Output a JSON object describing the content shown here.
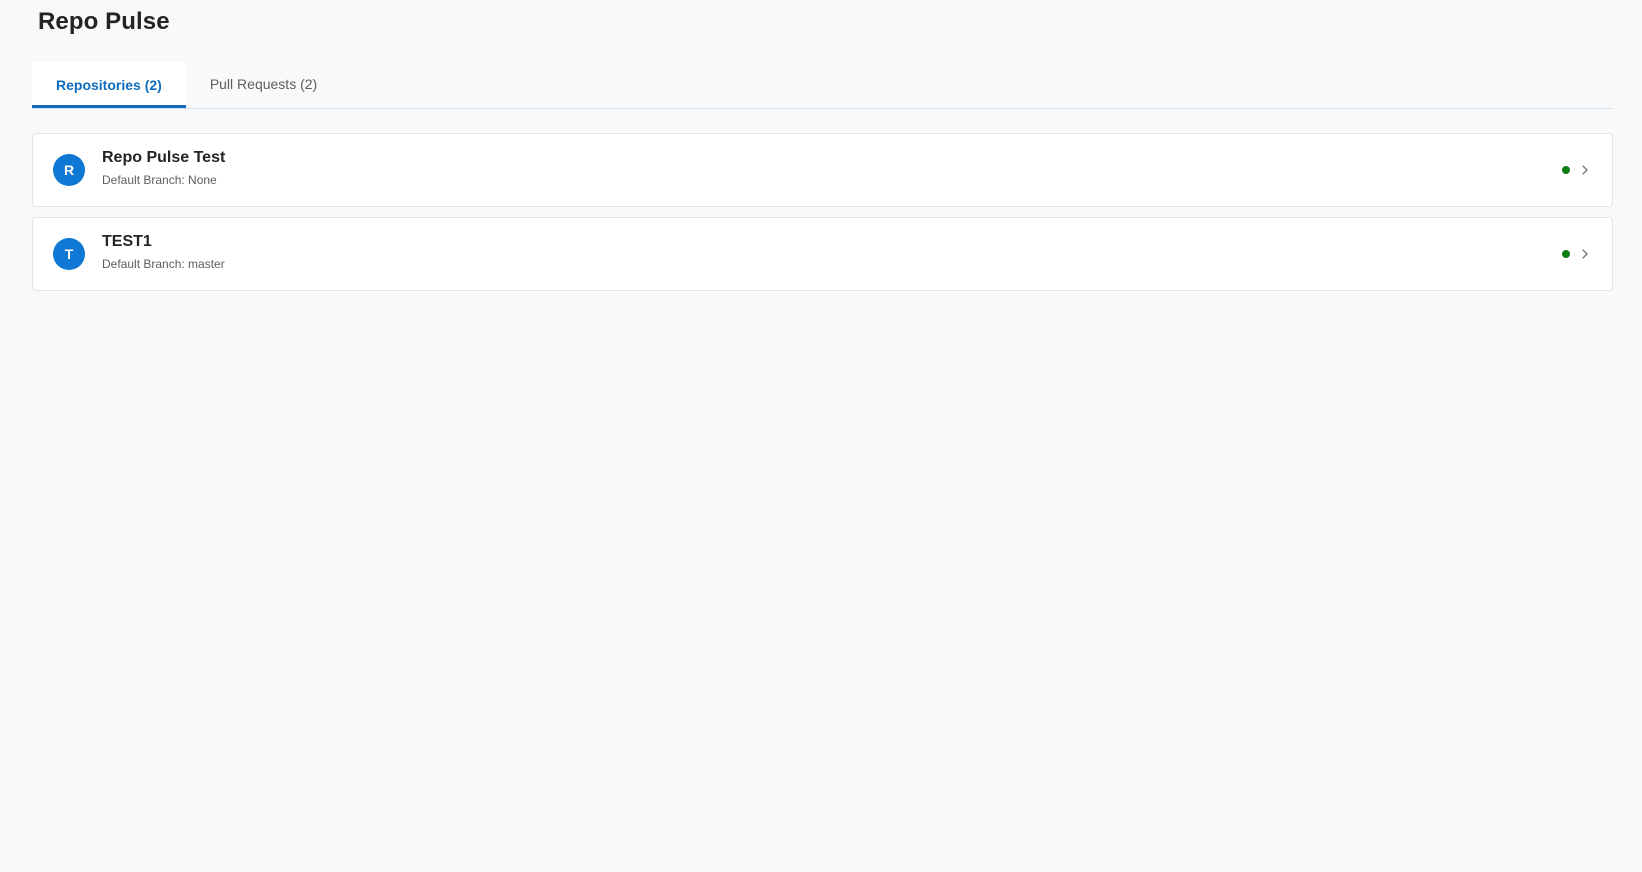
{
  "app": {
    "title": "Repo Pulse"
  },
  "tabs": [
    {
      "label": "Repositories (2)",
      "active": true
    },
    {
      "label": "Pull Requests (2)",
      "active": false
    }
  ],
  "repositories": [
    {
      "initial": "R",
      "name": "Repo Pulse Test",
      "branch": "Default Branch: None",
      "status_color": "#107c10"
    },
    {
      "initial": "T",
      "name": "TEST1",
      "branch": "Default Branch: master",
      "status_color": "#107c10"
    }
  ],
  "colors": {
    "accent": "#0f6cbd",
    "avatar": "#0f78d4",
    "status_ok": "#107c10",
    "background": "#f8f9fa"
  },
  "icons": {
    "chevron": "chevron-right-icon",
    "status": "status-dot"
  }
}
